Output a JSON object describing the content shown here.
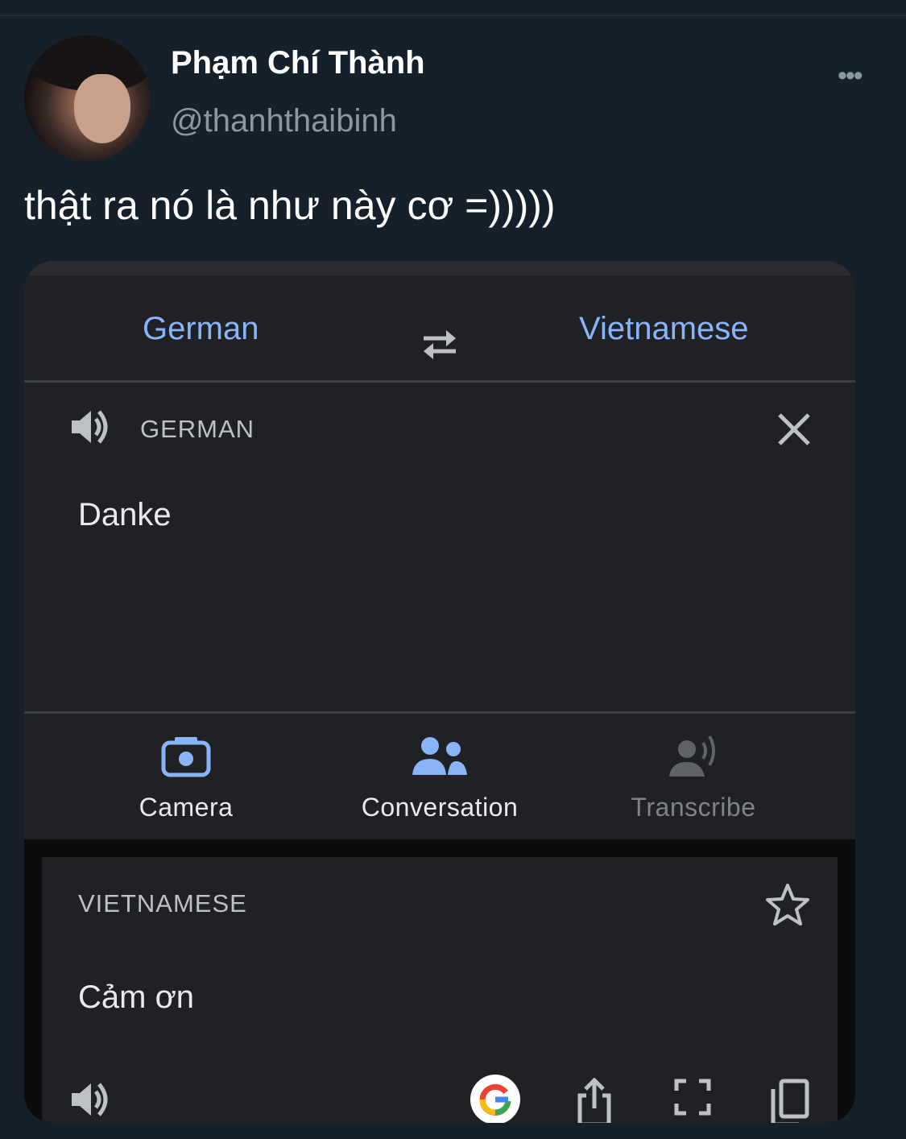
{
  "tweet": {
    "display_name": "Phạm Chí Thành",
    "handle": "@thanhthaibinh",
    "text": "thật ra nó là như này cơ =)))))",
    "more_icon": "more-horizontal-icon"
  },
  "translate": {
    "source_language": "German",
    "target_language": "Vietnamese",
    "source_label": "GERMAN",
    "source_text": "Danke",
    "tools": [
      {
        "label": "Camera",
        "icon": "camera-icon",
        "enabled": true
      },
      {
        "label": "Conversation",
        "icon": "conversation-icon",
        "enabled": true
      },
      {
        "label": "Transcribe",
        "icon": "transcribe-icon",
        "enabled": false
      }
    ],
    "target_label": "VIETNAMESE",
    "target_text": "Cảm ơn"
  },
  "colors": {
    "background": "#15202b",
    "accent_blue": "#8ab4f8",
    "panel": "#202124"
  }
}
